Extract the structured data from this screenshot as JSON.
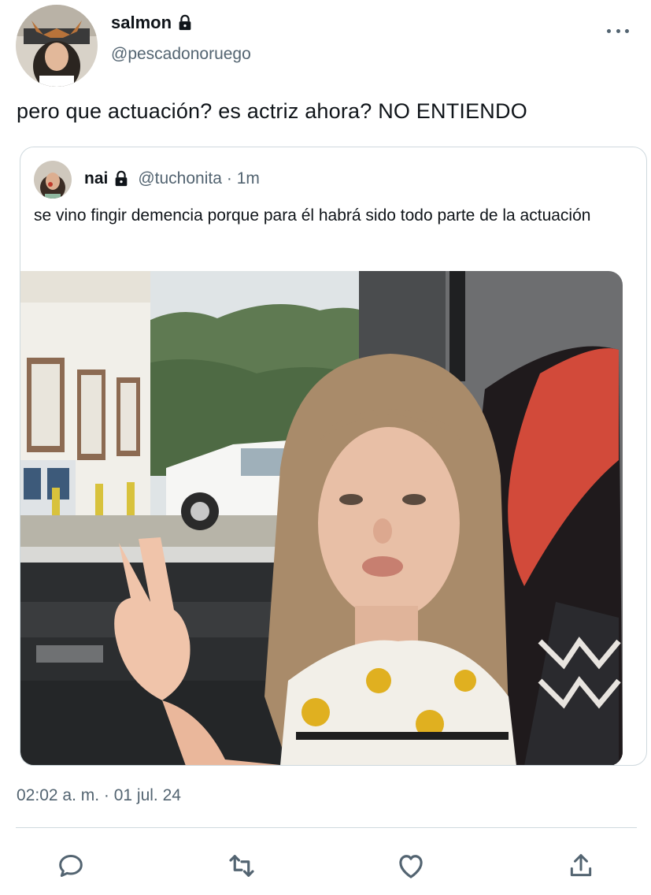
{
  "tweet": {
    "display_name": "salmon",
    "handle": "@pescadonoruego",
    "text": "pero que actuación? es actriz ahora? NO ENTIENDO",
    "timestamp": "02:02 a. m. · 01 jul. 24",
    "protected_icon": "lock-icon",
    "menu_icon": "more-options-icon"
  },
  "quoted": {
    "display_name": "nai",
    "handle": "@tuchonita",
    "time": "· 1m",
    "text": "se vino fingir demencia porque para él habrá sido todo parte de la actuación",
    "protected_icon": "lock-icon"
  },
  "actions": [
    {
      "name": "reply",
      "icon": "reply-icon"
    },
    {
      "name": "retweet",
      "icon": "retweet-icon"
    },
    {
      "name": "like",
      "icon": "heart-icon"
    },
    {
      "name": "share",
      "icon": "share-icon"
    }
  ],
  "colors": {
    "text_primary": "#0f1419",
    "text_secondary": "#536471",
    "accent": "#1d9bf0",
    "border": "#cfd9de"
  }
}
